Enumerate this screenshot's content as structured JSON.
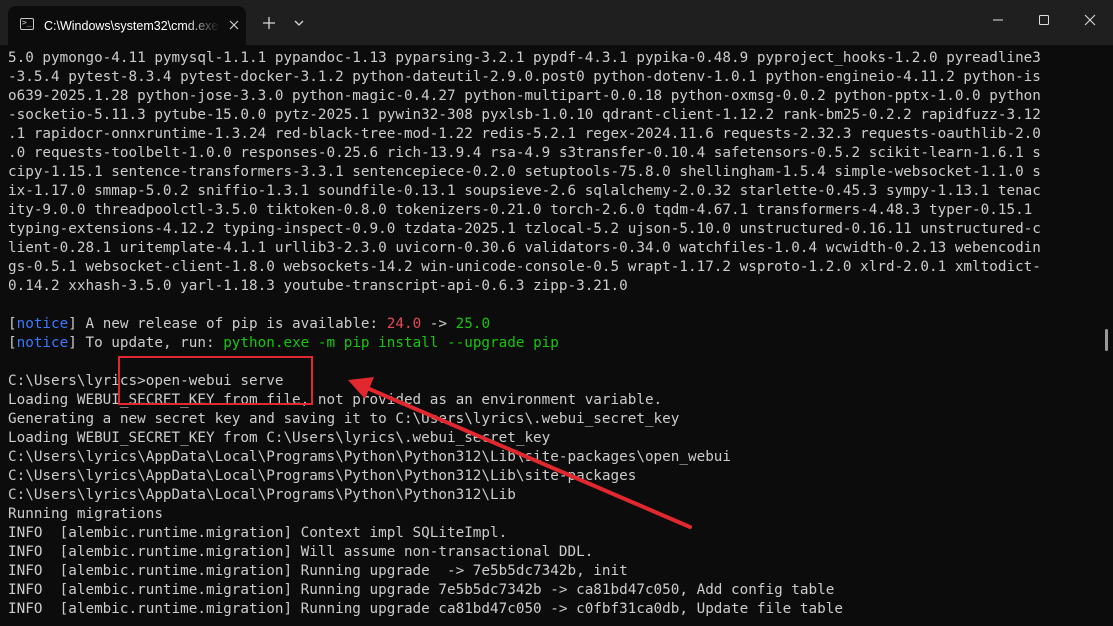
{
  "window": {
    "tab_title": "C:\\Windows\\system32\\cmd.exe",
    "tab_icon": "terminal-icon",
    "controls": {
      "close_tab": "close-icon",
      "new_tab": "plus-icon",
      "dropdown": "chevron-down-icon",
      "minimize": "minimize-icon",
      "maximize": "maximize-icon",
      "close": "close-icon"
    }
  },
  "colors": {
    "background": "#0c0c0c",
    "titlebar": "#1f1f1f",
    "text": "#cccccc",
    "notice": "#3b78ff",
    "old_version": "#e74856",
    "command": "#16c60c",
    "annotation": "#e0282e"
  },
  "terminal": {
    "package_lines": [
      "5.0 pymongo-4.11 pymysql-1.1.1 pypandoc-1.13 pyparsing-3.2.1 pypdf-4.3.1 pypika-0.48.9 pyproject_hooks-1.2.0 pyreadline3",
      "-3.5.4 pytest-8.3.4 pytest-docker-3.1.2 python-dateutil-2.9.0.post0 python-dotenv-1.0.1 python-engineio-4.11.2 python-is",
      "o639-2025.1.28 python-jose-3.3.0 python-magic-0.4.27 python-multipart-0.0.18 python-oxmsg-0.0.2 python-pptx-1.0.0 python",
      "-socketio-5.11.3 pytube-15.0.0 pytz-2025.1 pywin32-308 pyxlsb-1.0.10 qdrant-client-1.12.2 rank-bm25-0.2.2 rapidfuzz-3.12",
      ".1 rapidocr-onnxruntime-1.3.24 red-black-tree-mod-1.22 redis-5.2.1 regex-2024.11.6 requests-2.32.3 requests-oauthlib-2.0",
      ".0 requests-toolbelt-1.0.0 responses-0.25.6 rich-13.9.4 rsa-4.9 s3transfer-0.10.4 safetensors-0.5.2 scikit-learn-1.6.1 s",
      "cipy-1.15.1 sentence-transformers-3.3.1 sentencepiece-0.2.0 setuptools-75.8.0 shellingham-1.5.4 simple-websocket-1.1.0 s",
      "ix-1.17.0 smmap-5.0.2 sniffio-1.3.1 soundfile-0.13.1 soupsieve-2.6 sqlalchemy-2.0.32 starlette-0.45.3 sympy-1.13.1 tenac",
      "ity-9.0.0 threadpoolctl-3.5.0 tiktoken-0.8.0 tokenizers-0.21.0 torch-2.6.0 tqdm-4.67.1 transformers-4.48.3 typer-0.15.1",
      "typing-extensions-4.12.2 typing-inspect-0.9.0 tzdata-2025.1 tzlocal-5.2 ujson-5.10.0 unstructured-0.16.11 unstructured-c",
      "lient-0.28.1 uritemplate-4.1.1 urllib3-2.3.0 uvicorn-0.30.6 validators-0.34.0 watchfiles-1.0.4 wcwidth-0.2.13 webencodin",
      "gs-0.5.1 websocket-client-1.8.0 websockets-14.2 win-unicode-console-0.5 wrapt-1.17.2 wsproto-1.2.0 xlrd-2.0.1 xmltodict-",
      "0.14.2 xxhash-3.5.0 yarl-1.18.3 youtube-transcript-api-0.6.3 zipp-3.21.0"
    ],
    "notice_1": {
      "open": "[",
      "tag": "notice",
      "close": "]",
      "text": " A new release of pip is available: ",
      "old_version": "24.0",
      "arrow": " -> ",
      "new_version": "25.0"
    },
    "notice_2": {
      "open": "[",
      "tag": "notice",
      "close": "]",
      "text": " To update, run: ",
      "command": "python.exe -m pip install --upgrade pip"
    },
    "prompt_line": "C:\\Users\\lyrics>open-webui serve",
    "output_lines": [
      "Loading WEBUI_SECRET_KEY from file, not provided as an environment variable.",
      "Generating a new secret key and saving it to C:\\Users\\lyrics\\.webui_secret_key",
      "Loading WEBUI_SECRET_KEY from C:\\Users\\lyrics\\.webui_secret_key",
      "C:\\Users\\lyrics\\AppData\\Local\\Programs\\Python\\Python312\\Lib\\site-packages\\open_webui",
      "C:\\Users\\lyrics\\AppData\\Local\\Programs\\Python\\Python312\\Lib\\site-packages",
      "C:\\Users\\lyrics\\AppData\\Local\\Programs\\Python\\Python312\\Lib",
      "Running migrations",
      "INFO  [alembic.runtime.migration] Context impl SQLiteImpl.",
      "INFO  [alembic.runtime.migration] Will assume non-transactional DDL.",
      "INFO  [alembic.runtime.migration] Running upgrade  -> 7e5b5dc7342b, init",
      "INFO  [alembic.runtime.migration] Running upgrade 7e5b5dc7342b -> ca81bd47c050, Add config table",
      "INFO  [alembic.runtime.migration] Running upgrade ca81bd47c050 -> c0fbf31ca0db, Update file table"
    ]
  }
}
